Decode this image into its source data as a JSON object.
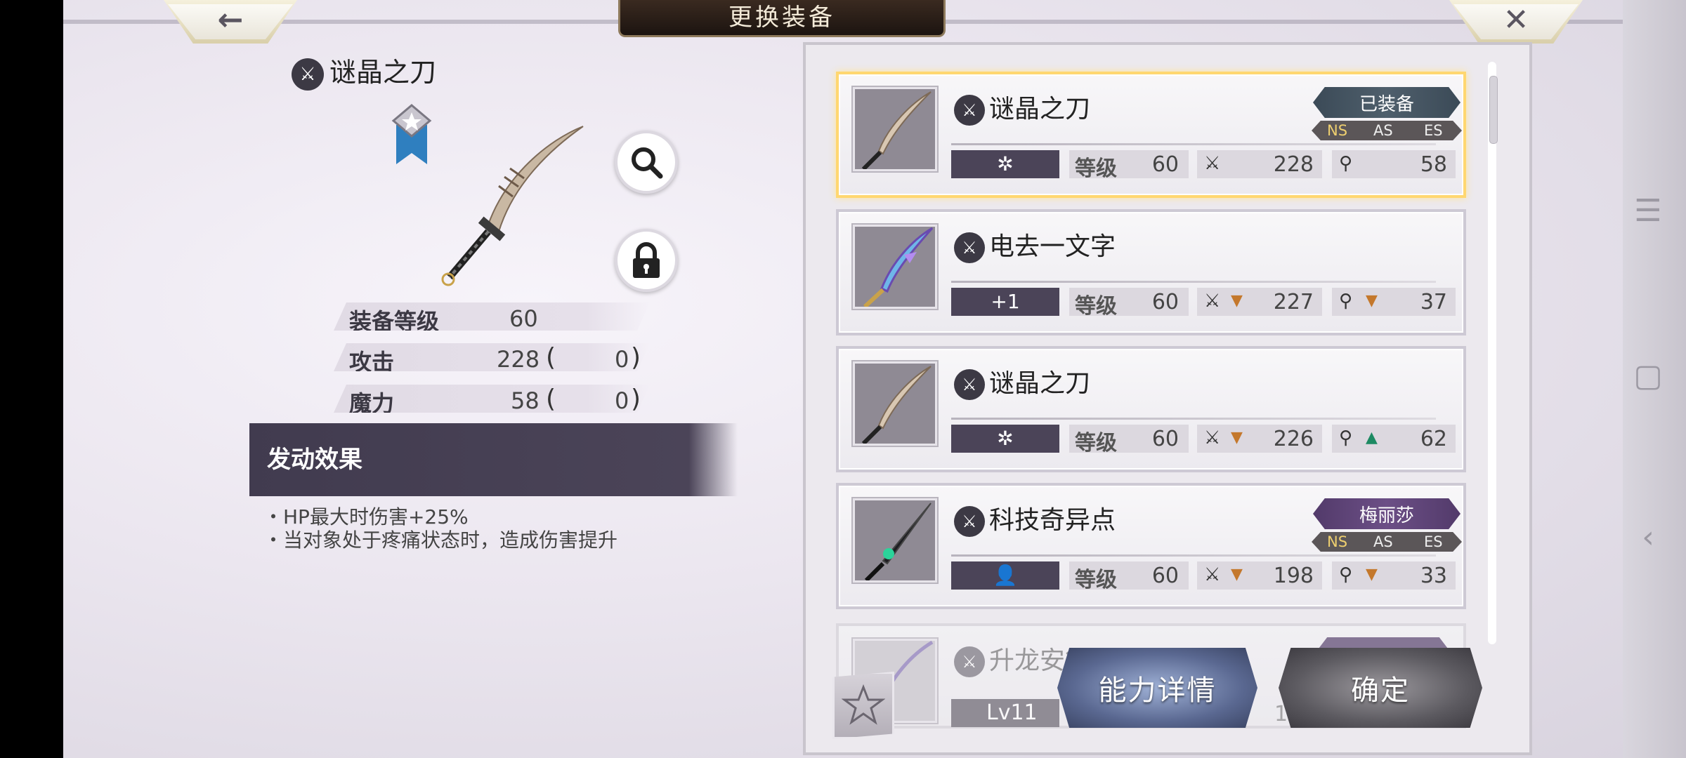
{
  "header": {
    "title": "更换装备",
    "back_icon": "←",
    "close_icon": "✕"
  },
  "detail": {
    "name": "谜晶之刀",
    "stats": [
      {
        "label": "装备等级",
        "value": "60"
      },
      {
        "label": "攻击",
        "value": "228",
        "bonus": "0"
      },
      {
        "label": "魔力",
        "value": "58",
        "bonus": "0"
      }
    ],
    "effect_title": "发动效果",
    "effects": [
      "・HP最大时伤害+25%",
      "・当对象处于疼痛状态时，造成伤害提升"
    ]
  },
  "list": {
    "level_label": "等级",
    "items": [
      {
        "name": "谜晶之刀",
        "badge": "✲",
        "level": "60",
        "attack": "228",
        "magic": "58",
        "tag": "已装备",
        "slots": [
          "NS",
          "AS",
          "ES"
        ]
      },
      {
        "name": "电去一文字",
        "badge": "+1",
        "level": "60",
        "attack": "227",
        "magic": "37"
      },
      {
        "name": "谜晶之刀",
        "badge": "✲",
        "level": "60",
        "attack": "226",
        "magic": "62"
      },
      {
        "name": "科技奇异点",
        "badge": "👤",
        "level": "60",
        "attack": "198",
        "magic": "33",
        "tag": "梅丽莎",
        "slots": [
          "NS",
          "AS",
          "ES"
        ]
      },
      {
        "name": "升龙安得",
        "chip": "Lv11",
        "partial": "1"
      }
    ]
  },
  "buttons": {
    "ability_detail": "能力详情",
    "confirm": "确定"
  },
  "colors": {
    "equipped_border": "#ffd770",
    "effect_bar": "#413b4f",
    "down_arrow": "#c4782c",
    "up_arrow": "#1d8a62"
  }
}
